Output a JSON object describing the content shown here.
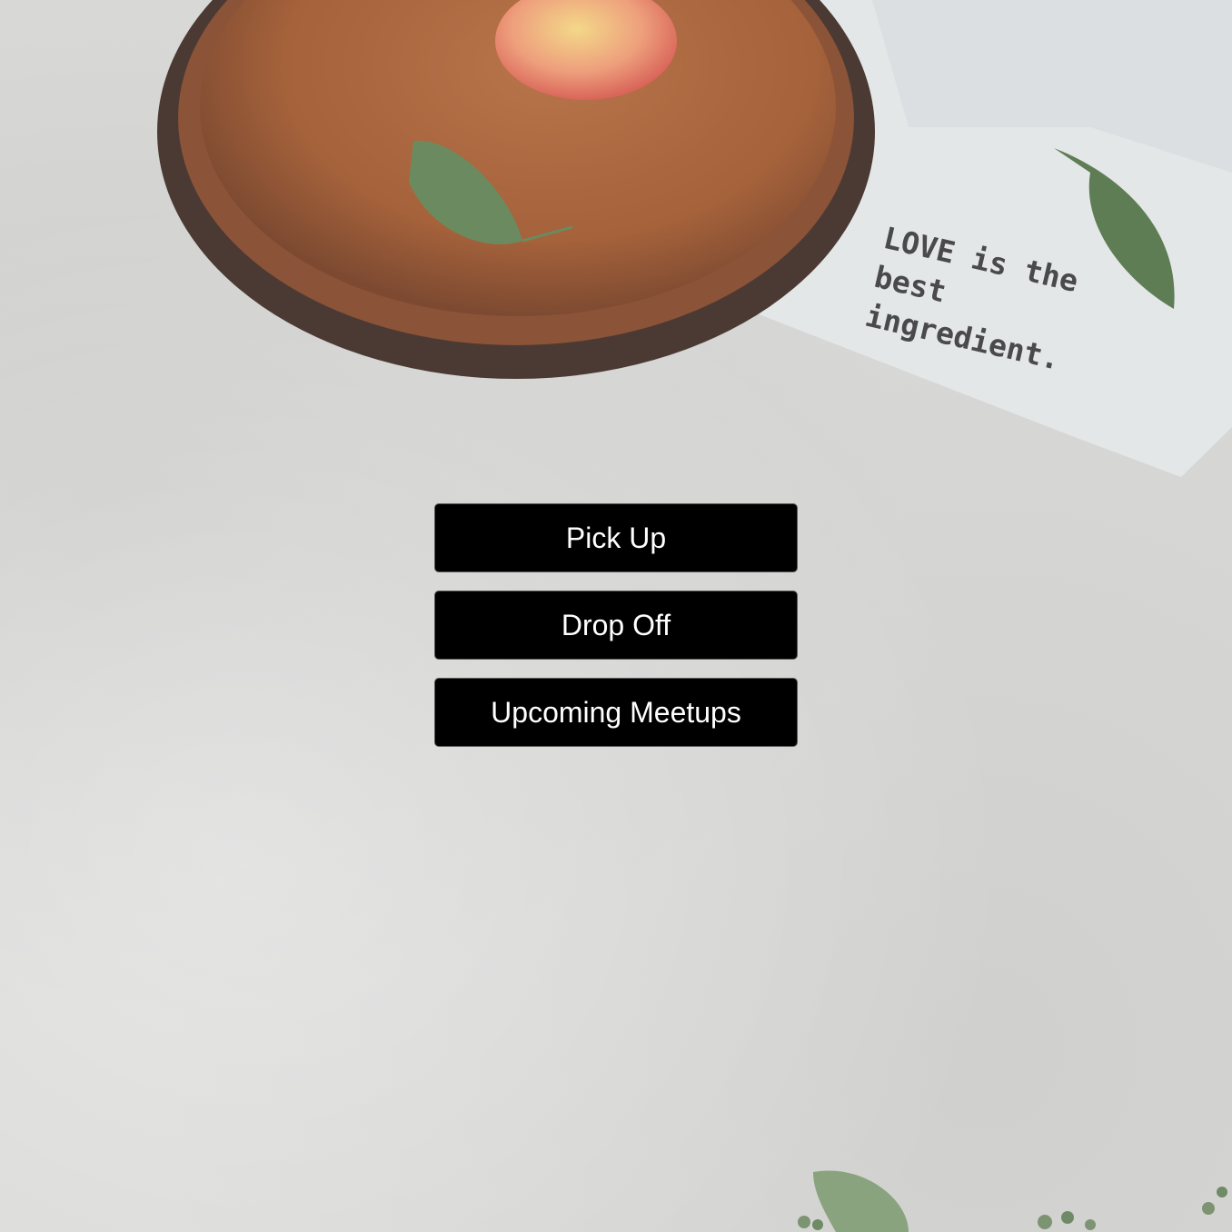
{
  "menu": {
    "pick_up_label": "Pick Up",
    "drop_off_label": "Drop Off",
    "upcoming_meetups_label": "Upcoming Meetups"
  },
  "background": {
    "napkin_text_line1": "LOVE is the",
    "napkin_text_line2": "best ingredient."
  },
  "colors": {
    "button_bg": "#000000",
    "button_text": "#ffffff",
    "concrete": "#d9d9d7"
  }
}
